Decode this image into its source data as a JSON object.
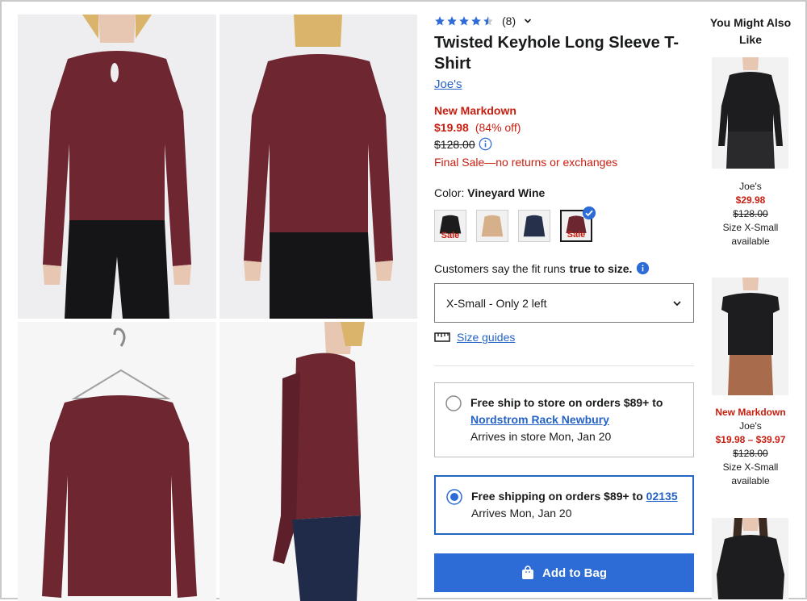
{
  "product": {
    "rating_value": 4.5,
    "review_count": "(8)",
    "title": "Twisted Keyhole Long Sleeve T-Shirt",
    "brand": "Joe's",
    "markdown_label": "New Markdown",
    "price": "$19.98",
    "discount": "(84% off)",
    "original_price": "$128.00",
    "final_sale_note": "Final Sale—no returns or exchanges",
    "color_label": "Color:",
    "color_value": "Vineyard Wine",
    "swatches": [
      {
        "color": "#1c1c1c",
        "sale": "Sale"
      },
      {
        "color": "#d6b08a",
        "sale": ""
      },
      {
        "color": "#26304a",
        "sale": ""
      },
      {
        "color": "#6b2630",
        "sale": "Sale"
      }
    ],
    "fit_text_prefix": "Customers say the fit runs",
    "fit_text_bold": "true to size.",
    "size_selected": "X-Small - Only 2 left",
    "size_guides_label": "Size guides",
    "ship_store_heading": "Free ship to store on orders $89+ to",
    "ship_store_link": "Nordstrom Rack Newbury",
    "ship_store_arrival": "Arrives in store Mon, Jan 20",
    "ship_home_heading": "Free shipping on orders $89+ to",
    "ship_home_link": "02135",
    "ship_home_arrival": "Arrives Mon, Jan 20",
    "add_to_bag": "Add to Bag"
  },
  "recommendations": {
    "title": "You Might Also Like",
    "items": [
      {
        "markdown": "",
        "brand": "Joe's",
        "price": "$29.98",
        "original": "$128.00",
        "size": "Size X-Small available"
      },
      {
        "markdown": "New Markdown",
        "brand": "Joe's",
        "price": "$19.98 – $39.97",
        "original": "$128.00",
        "size": "Size X-Small available"
      }
    ]
  },
  "colors": {
    "accent": "#2d6bd7",
    "sale_red": "#c81e10",
    "garment": "#6b2630"
  }
}
